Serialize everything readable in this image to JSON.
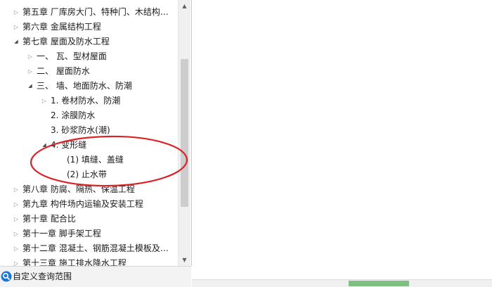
{
  "tree": {
    "items": [
      {
        "label": "第五章  厂库房大门、特种门、木结构…",
        "level": 0,
        "state": "collapsed"
      },
      {
        "label": "第六章  金属结构工程",
        "level": 0,
        "state": "collapsed"
      },
      {
        "label": "第七章  屋面及防水工程",
        "level": 0,
        "state": "expanded"
      },
      {
        "label": "一、  瓦、型材屋面",
        "level": 1,
        "state": "collapsed"
      },
      {
        "label": "二、   屋面防水",
        "level": 1,
        "state": "collapsed"
      },
      {
        "label": "三、  墙、地面防水、防潮",
        "level": 1,
        "state": "expanded"
      },
      {
        "label": "1.  卷材防水、防潮",
        "level": 2,
        "state": "collapsed"
      },
      {
        "label": "2.  涂膜防水",
        "level": 2,
        "state": "leaf"
      },
      {
        "label": "3.  砂浆防水(潮)",
        "level": 2,
        "state": "leaf"
      },
      {
        "label": "4.  变形缝",
        "level": 2,
        "state": "expanded"
      },
      {
        "label": "(1)  填缝、盖缝",
        "level": 3,
        "state": "leaf"
      },
      {
        "label": "(2)  止水带",
        "level": 3,
        "state": "leaf"
      },
      {
        "label": "第八章  防腐、隔热、保温工程",
        "level": 0,
        "state": "collapsed"
      },
      {
        "label": "第九章  构件场内运输及安装工程",
        "level": 0,
        "state": "collapsed"
      },
      {
        "label": "第十章  配合比",
        "level": 0,
        "state": "collapsed"
      },
      {
        "label": "第十一章  脚手架工程",
        "level": 0,
        "state": "collapsed"
      },
      {
        "label": "第十二章  混凝土、钢筋混凝土模板及…",
        "level": 0,
        "state": "collapsed"
      },
      {
        "label": "第十三章  施工排水降水工程",
        "level": 0,
        "state": "collapsed"
      }
    ]
  },
  "status_bar": {
    "link_label": "自定义查询范围",
    "icon": "search-icon"
  },
  "colors": {
    "annotation": "#d9242a",
    "accent": "#1e78d2",
    "green_tab": "#7fbf7f"
  }
}
